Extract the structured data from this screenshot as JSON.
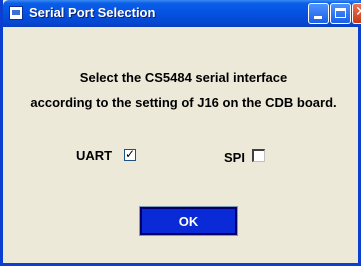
{
  "window": {
    "title": "Serial Port Selection"
  },
  "message": {
    "line1": "Select the CS5484 serial interface",
    "line2": "according to the setting of J16 on the CDB board."
  },
  "options": {
    "uart": {
      "label": "UART",
      "checked": true
    },
    "spi": {
      "label": "SPI",
      "checked": false
    }
  },
  "ok_button": {
    "label": "OK"
  },
  "colors": {
    "title_bar": "#0551e0",
    "window_bg": "#ece9d8",
    "ok_button_bg": "#0a2ad8"
  },
  "icons": {
    "app": "app-window-icon",
    "minimize": "minimize-icon",
    "maximize": "maximize-icon",
    "close": "close-icon",
    "check": "✓"
  }
}
